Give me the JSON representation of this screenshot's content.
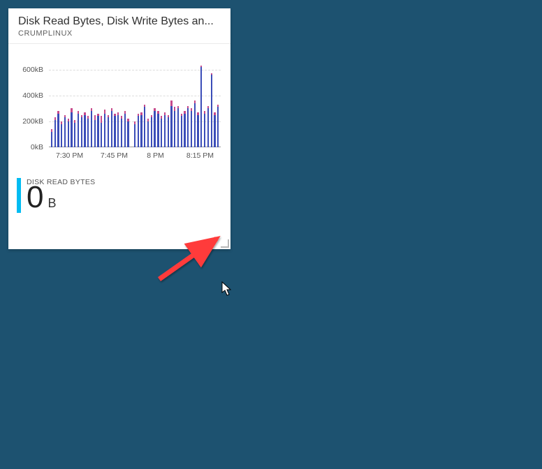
{
  "tile": {
    "title": "Disk Read Bytes, Disk Write Bytes an...",
    "subtitle": "CRUMPLINUX"
  },
  "metric": {
    "label": "DISK READ BYTES",
    "value": "0",
    "unit": "B"
  },
  "colors": {
    "accent": "#00bcf2",
    "series_read": "#3b4db8",
    "series_write": "#c74a8c",
    "arrow": "#ff3b3b"
  },
  "chart_data": {
    "type": "bar",
    "ylabel": "",
    "xlabel": "",
    "ylim": [
      0,
      700
    ],
    "y_ticks": [
      0,
      200,
      400,
      600
    ],
    "y_tick_labels": [
      "0kB",
      "200kB",
      "400kB",
      "600kB"
    ],
    "x_ticks": [
      "7:30 PM",
      "7:45 PM",
      "8 PM",
      "8:15 PM"
    ],
    "x_tick_positions": [
      0.12,
      0.38,
      0.62,
      0.88
    ],
    "series": [
      {
        "name": "Disk Read Bytes",
        "values": [
          120,
          210,
          260,
          180,
          230,
          200,
          270,
          190,
          260,
          230,
          250,
          220,
          280,
          210,
          240,
          190,
          260,
          230,
          280,
          240,
          250,
          220,
          260,
          200,
          0,
          180,
          240,
          250,
          310,
          200,
          230,
          280,
          260,
          220,
          250,
          230,
          320,
          280,
          300,
          240,
          260,
          300,
          280,
          340,
          250,
          620,
          260,
          300,
          560,
          250,
          310
        ]
      },
      {
        "name": "Disk Write Bytes",
        "values": [
          140,
          230,
          280,
          200,
          250,
          220,
          300,
          210,
          280,
          250,
          270,
          240,
          300,
          250,
          260,
          240,
          290,
          250,
          300,
          260,
          270,
          240,
          280,
          220,
          0,
          200,
          260,
          270,
          330,
          220,
          250,
          300,
          280,
          240,
          270,
          250,
          360,
          310,
          320,
          260,
          280,
          320,
          300,
          360,
          270,
          630,
          280,
          320,
          570,
          270,
          330
        ]
      }
    ]
  }
}
